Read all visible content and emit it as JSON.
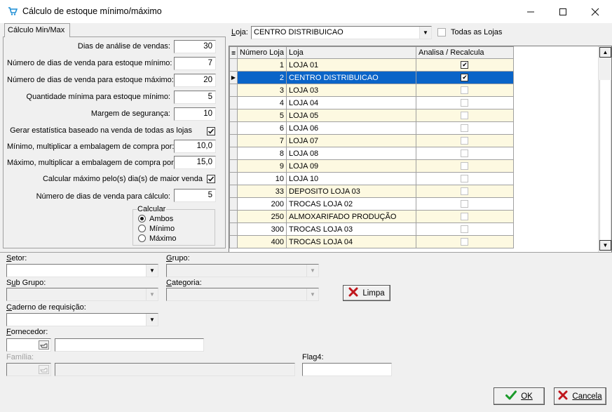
{
  "window": {
    "title": "Cálculo de estoque mínimo/máximo",
    "minimize": "—",
    "maximize": "☐",
    "close": "✕"
  },
  "tab": {
    "label": "Cálculo Min/Max"
  },
  "params": {
    "dias_analise_label": "Dias de análise de vendas:",
    "dias_analise_value": "30",
    "dias_minimo_label": "Número de dias de venda para estoque mínimo:",
    "dias_minimo_value": "7",
    "dias_maximo_label": "Número de dias de venda para estoque máximo:",
    "dias_maximo_value": "20",
    "qtd_minima_label": "Quantidade mínima para estoque mínimo:",
    "qtd_minima_value": "5",
    "margem_label": "Margem de segurança:",
    "margem_value": "10",
    "gerar_estatistica_label": "Gerar estatística baseado na venda de todas as lojas",
    "gerar_estatistica_checked": true,
    "mult_minimo_label": "Mínimo, multiplicar a embalagem de compra por:",
    "mult_minimo_value": "10,0",
    "mult_maximo_label": "Máximo, multiplicar a embalagem de compra por:",
    "mult_maximo_value": "15,0",
    "calc_maximo_label": "Calcular máximo pelo(s) dia(s) de maior venda",
    "calc_maximo_checked": true,
    "dias_calculo_label": "Número de dias de venda para cálculo:",
    "dias_calculo_value": "5",
    "calcular_group_label": "Calcular",
    "calcular_options": [
      "Ambos",
      "Mínimo",
      "Máximo"
    ],
    "calcular_selected": "Ambos"
  },
  "loja": {
    "label": "Loja:",
    "value": "CENTRO DISTRIBUICAO",
    "todas_label": "Todas as Lojas",
    "todas_checked": false
  },
  "grid": {
    "columns": [
      "Número Loja",
      "Loja",
      "Analisa / Recalcula"
    ],
    "rows": [
      {
        "numero": "1",
        "loja": "LOJA 01",
        "analisa": true
      },
      {
        "numero": "2",
        "loja": "CENTRO DISTRIBUICAO",
        "analisa": true,
        "selected": true
      },
      {
        "numero": "3",
        "loja": "LOJA 03",
        "analisa": false
      },
      {
        "numero": "4",
        "loja": "LOJA 04",
        "analisa": false
      },
      {
        "numero": "5",
        "loja": "LOJA 05",
        "analisa": false
      },
      {
        "numero": "6",
        "loja": "LOJA 06",
        "analisa": false
      },
      {
        "numero": "7",
        "loja": "LOJA 07",
        "analisa": false
      },
      {
        "numero": "8",
        "loja": "LOJA 08",
        "analisa": false
      },
      {
        "numero": "9",
        "loja": "LOJA 09",
        "analisa": false
      },
      {
        "numero": "10",
        "loja": "LOJA 10",
        "analisa": false
      },
      {
        "numero": "33",
        "loja": "DEPOSITO LOJA 03",
        "analisa": false
      },
      {
        "numero": "200",
        "loja": "TROCAS LOJA 02",
        "analisa": false
      },
      {
        "numero": "250",
        "loja": "ALMOXARIFADO PRODUÇÃO",
        "analisa": false
      },
      {
        "numero": "300",
        "loja": "TROCAS LOJA 03",
        "analisa": false
      },
      {
        "numero": "400",
        "loja": "TROCAS LOJA 04",
        "analisa": false
      }
    ]
  },
  "filters": {
    "setor_label": "Setor:",
    "setor_value": "",
    "grupo_label": "Grupo:",
    "grupo_value": "",
    "subgrupo_label": "Sub Grupo:",
    "subgrupo_value": "",
    "categoria_label": "Categoria:",
    "categoria_value": "",
    "caderno_label": "Caderno de requisição:",
    "caderno_value": "",
    "fornecedor_label": "Fornecedor:",
    "fornecedor_code": "",
    "fornecedor_name": "",
    "familia_label": "Família:",
    "familia_code": "",
    "familia_name": "",
    "flag4_label": "Flag4:",
    "flag4_value": ""
  },
  "buttons": {
    "limpa": "Limpa",
    "ok": "OK",
    "cancela": "Cancela"
  },
  "colors": {
    "selection": "#0a64c8",
    "row_alt": "#fdf9e1",
    "title_icon": "#1e8fd6"
  },
  "icons": {
    "title": "cart-icon",
    "lookup": "lookup-hand-icon",
    "limpa": "red-x-icon",
    "ok": "green-check-icon",
    "cancela": "red-x-icon"
  }
}
